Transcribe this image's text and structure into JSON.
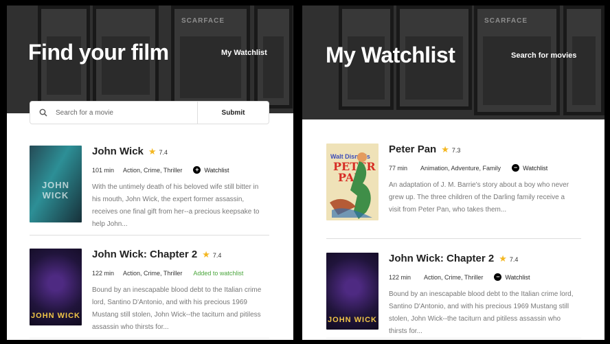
{
  "left_panel": {
    "title": "Find your film",
    "nav_link": "My Watchlist",
    "search": {
      "placeholder": "Search for a movie",
      "submit_label": "Submit"
    },
    "hero_poster_text": "SCARFACE",
    "movies": [
      {
        "title": "John Wick",
        "rating": "7.4",
        "runtime": "101 min",
        "genres": "Action, Crime, Thriller",
        "action_label": "Watchlist",
        "action_icon": "plus-icon",
        "description": "With the untimely death of his beloved wife still bitter in his mouth, John Wick, the expert former assassin, receives one final gift from her--a precious keepsake to help John..."
      },
      {
        "title": "John Wick: Chapter 2",
        "rating": "7.4",
        "runtime": "122 min",
        "genres": "Action, Crime, Thriller",
        "status_label": "Added to watchlist",
        "description": "Bound by an inescapable blood debt to the Italian crime lord, Santino D'Antonio, and with his precious 1969 Mustang still stolen, John Wick--the taciturn and pitiless assassin who thirsts for..."
      }
    ]
  },
  "right_panel": {
    "title": "My Watchlist",
    "nav_link": "Search for movies",
    "hero_poster_text": "SCARFACE",
    "movies": [
      {
        "title": "Peter Pan",
        "rating": "7.3",
        "runtime": "77 min",
        "genres": "Animation, Adventure, Family",
        "action_label": "Watchlist",
        "action_icon": "minus-icon",
        "description": "An adaptation of J. M. Barrie's story about a boy who never grew up. The three children of the Darling family receive a visit from Peter Pan, who takes them..."
      },
      {
        "title": "John Wick: Chapter 2",
        "rating": "7.4",
        "runtime": "122 min",
        "genres": "Action, Crime, Thriller",
        "action_label": "Watchlist",
        "action_icon": "minus-icon",
        "description": "Bound by an inescapable blood debt to the Italian crime lord, Santino D'Antonio, and with his precious 1969 Mustang still stolen, John Wick--the taciturn and pitiless assassin who thirsts for..."
      }
    ]
  },
  "poster_text": {
    "john_wick": "JOHN WICK",
    "john_wick_2": "JOHN WICK",
    "peter_pan_studio": "Walt Disney's",
    "peter_pan_title": "PETER PAN"
  },
  "colors": {
    "accent_star": "#f4b721",
    "added_green": "#49a53b",
    "hero_dark": "#3b3b3b"
  }
}
